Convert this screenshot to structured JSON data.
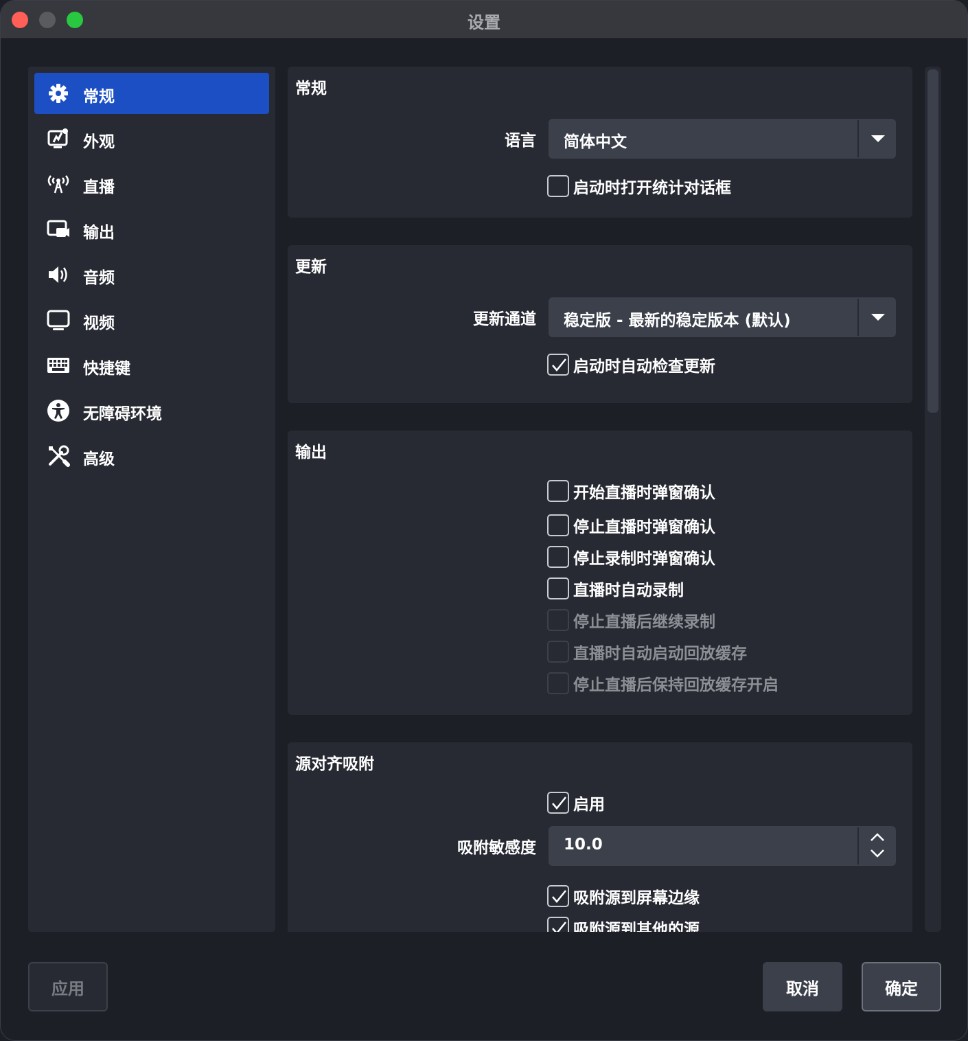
{
  "window": {
    "title": "设置"
  },
  "sidebar": {
    "items": [
      {
        "label": "常规",
        "icon": "gear-icon",
        "active": true
      },
      {
        "label": "外观",
        "icon": "appearance-icon"
      },
      {
        "label": "直播",
        "icon": "antenna-icon"
      },
      {
        "label": "输出",
        "icon": "output-icon"
      },
      {
        "label": "音频",
        "icon": "speaker-icon"
      },
      {
        "label": "视频",
        "icon": "monitor-icon"
      },
      {
        "label": "快捷键",
        "icon": "keyboard-icon"
      },
      {
        "label": "无障碍环境",
        "icon": "accessibility-icon"
      },
      {
        "label": "高级",
        "icon": "tools-icon"
      }
    ]
  },
  "general": {
    "title": "常规",
    "language_label": "语言",
    "language_value": "简体中文",
    "open_stats": {
      "label": "启动时打开统计对话框",
      "checked": false
    }
  },
  "update": {
    "title": "更新",
    "channel_label": "更新通道",
    "channel_value": "稳定版 - 最新的稳定版本 (默认)",
    "auto_check": {
      "label": "启动时自动检查更新",
      "checked": true
    }
  },
  "output": {
    "title": "输出",
    "options": [
      {
        "label": "开始直播时弹窗确认",
        "checked": false,
        "disabled": false
      },
      {
        "label": "停止直播时弹窗确认",
        "checked": false,
        "disabled": false
      },
      {
        "label": "停止录制时弹窗确认",
        "checked": false,
        "disabled": false
      },
      {
        "label": "直播时自动录制",
        "checked": false,
        "disabled": false
      },
      {
        "label": "停止直播后继续录制",
        "checked": false,
        "disabled": true
      },
      {
        "label": "直播时自动启动回放缓存",
        "checked": false,
        "disabled": true
      },
      {
        "label": "停止直播后保持回放缓存开启",
        "checked": false,
        "disabled": true
      }
    ]
  },
  "snapping": {
    "title": "源对齐吸附",
    "enable": {
      "label": "启用",
      "checked": true
    },
    "sensitivity_label": "吸附敏感度",
    "sensitivity_value": "10.0",
    "screen_edges": {
      "label": "吸附源到屏幕边缘",
      "checked": true
    },
    "other_sources": {
      "label": "吸附源到其他的源",
      "checked": true
    }
  },
  "buttons": {
    "apply": "应用",
    "cancel": "取消",
    "ok": "确定"
  },
  "colors": {
    "accent": "#1c4fc4",
    "background": "#1d1f26",
    "panel": "#272a33",
    "control": "#3c404b"
  }
}
